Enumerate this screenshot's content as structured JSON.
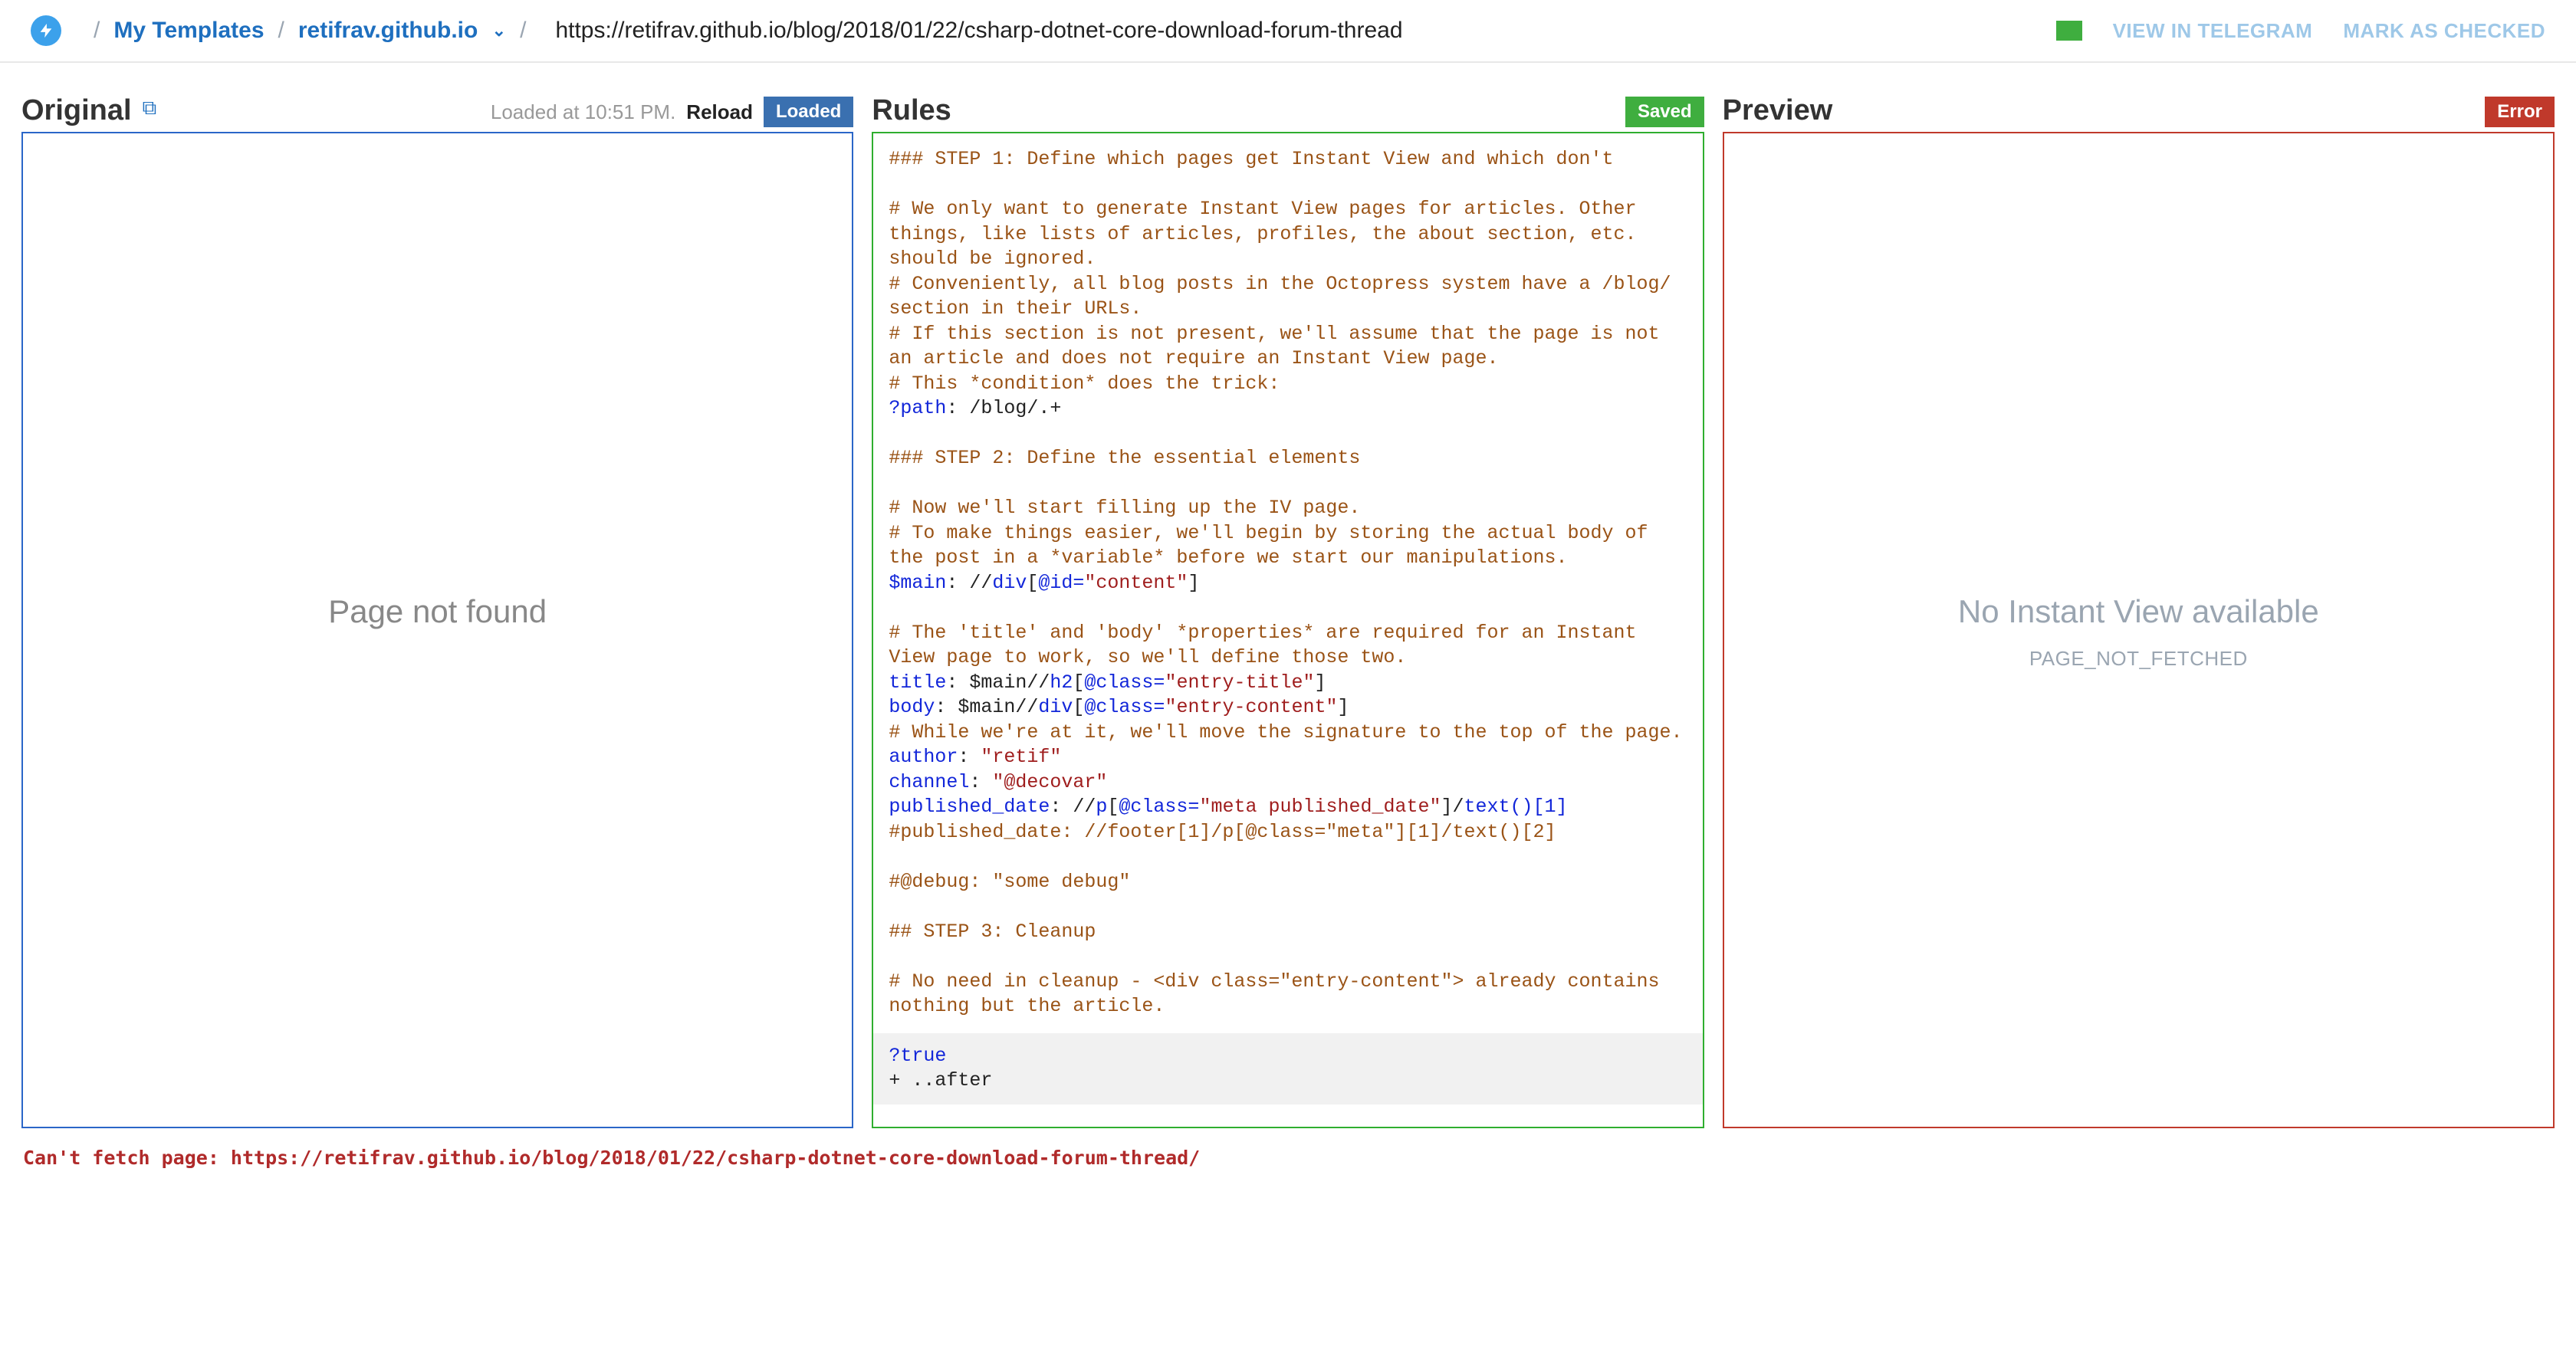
{
  "header": {
    "my_templates": "My Templates",
    "domain": "retifrav.github.io",
    "url": "https://retifrav.github.io/blog/2018/01/22/csharp-dotnet-core-download-forum-thread",
    "view_in_telegram": "VIEW IN TELEGRAM",
    "mark_as_checked": "MARK AS CHECKED"
  },
  "original": {
    "title": "Original",
    "loaded_at_prefix": "Loaded at ",
    "loaded_at_time": "10:51 PM.",
    "reload": "Reload",
    "badge": "Loaded",
    "message": "Page not found"
  },
  "rules": {
    "title": "Rules",
    "badge": "Saved",
    "lines": [
      {
        "t": "comment",
        "v": "### STEP 1: Define which pages get Instant View and which don't"
      },
      {
        "t": "blank",
        "v": ""
      },
      {
        "t": "comment",
        "v": "# We only want to generate Instant View pages for articles. Other things, like lists of articles, profiles, the about section, etc. should be ignored."
      },
      {
        "t": "comment",
        "v": "# Conveniently, all blog posts in the Octopress system have a /blog/ section in their URLs."
      },
      {
        "t": "comment",
        "v": "# If this section is not present, we'll assume that the page is not an article and does not require an Instant View page."
      },
      {
        "t": "comment",
        "v": "# This *condition* does the trick:"
      },
      {
        "t": "kv",
        "k": "?path",
        "rest": ": /blog/.+"
      },
      {
        "t": "blank",
        "v": ""
      },
      {
        "t": "comment",
        "v": "### STEP 2: Define the essential elements"
      },
      {
        "t": "blank",
        "v": ""
      },
      {
        "t": "comment",
        "v": "# Now we'll start filling up the IV page."
      },
      {
        "t": "comment",
        "v": "# To make things easier, we'll begin by storing the actual body of the post in a *variable* before we start our manipulations."
      },
      {
        "t": "xpath",
        "k": "$main",
        "rest": ": //",
        "el": "div",
        "attr": "[@id=",
        "str": "\"content\"",
        "tail": "]"
      },
      {
        "t": "blank",
        "v": ""
      },
      {
        "t": "comment",
        "v": "# The 'title' and 'body' *properties* are required for an Instant View page to work, so we'll define those two."
      },
      {
        "t": "xpath",
        "k": "title",
        "rest": ": $main//",
        "el": "h2",
        "attr": "[@class=",
        "str": "\"entry-title\"",
        "tail": "]"
      },
      {
        "t": "xpath",
        "k": "body",
        "rest": ": $main//",
        "el": "div",
        "attr": "[@class=",
        "str": "\"entry-content\"",
        "tail": "]"
      },
      {
        "t": "comment",
        "v": "# While we're at it, we'll move the signature to the top of the page."
      },
      {
        "t": "kvstr",
        "k": "author",
        "rest": ": ",
        "str": "\"retif\""
      },
      {
        "t": "kvstr",
        "k": "channel",
        "rest": ": ",
        "str": "\"@decovar\""
      },
      {
        "t": "pub",
        "k": "published_date",
        "rest": ": //",
        "el": "p",
        "attr": "[@class=",
        "str": "\"meta published_date\"",
        "tail": "]/",
        "m": "text()[1]"
      },
      {
        "t": "comment",
        "v": "#published_date: //footer[1]/p[@class=\"meta\"][1]/text()[2]"
      },
      {
        "t": "blank",
        "v": ""
      },
      {
        "t": "comment",
        "v": "#@debug: \"some debug\""
      },
      {
        "t": "blank",
        "v": ""
      },
      {
        "t": "comment",
        "v": "## STEP 3: Cleanup"
      },
      {
        "t": "blank",
        "v": ""
      },
      {
        "t": "comment",
        "v": "# No need in cleanup - <div class=\"entry-content\"> already contains nothing but the article."
      }
    ],
    "extra_true": "?true",
    "extra_after": "+ ..after"
  },
  "preview": {
    "title": "Preview",
    "badge": "Error",
    "message": "No Instant View available",
    "sub": "PAGE_NOT_FETCHED"
  },
  "footer_error": "Can't fetch page: https://retifrav.github.io/blog/2018/01/22/csharp-dotnet-core-download-forum-thread/"
}
